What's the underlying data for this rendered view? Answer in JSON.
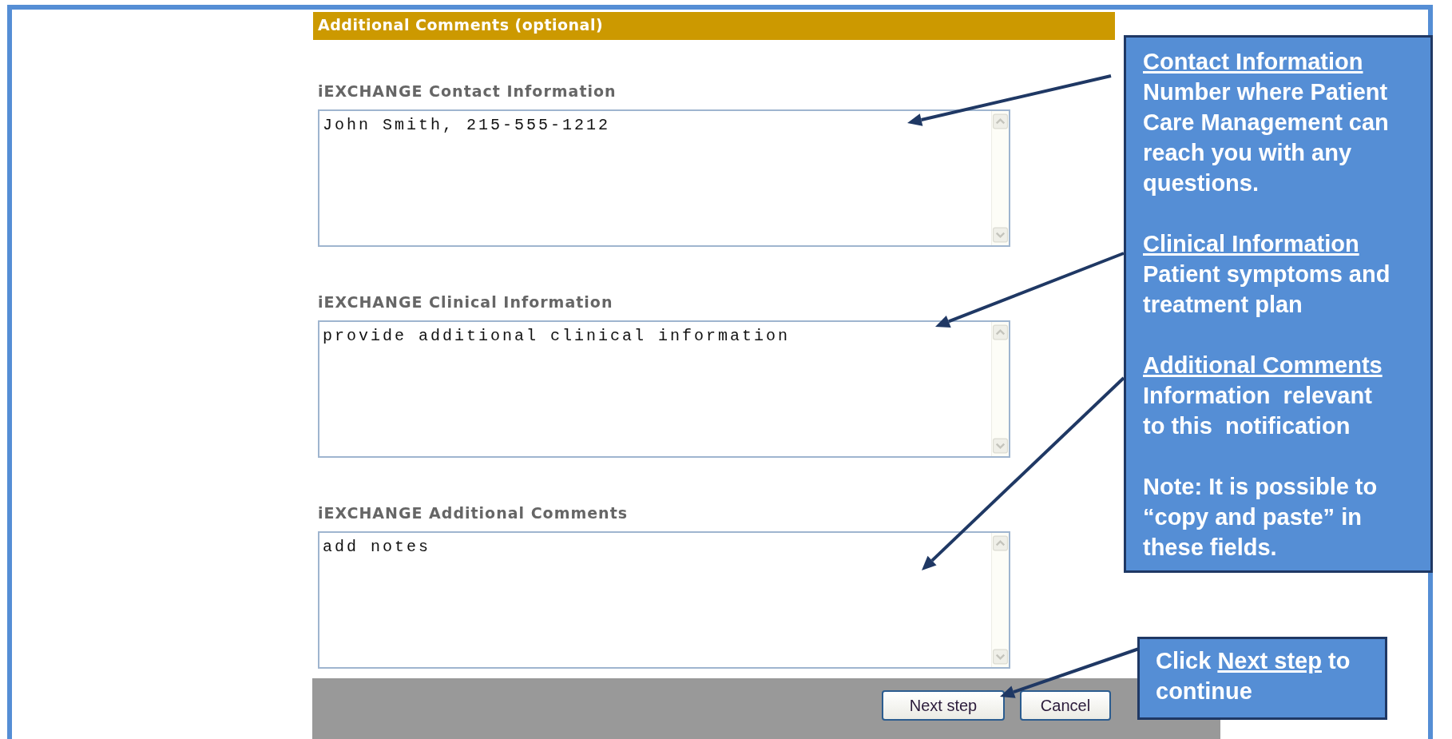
{
  "form": {
    "title": "Additional Comments (optional)",
    "fields": [
      {
        "label": "iEXCHANGE Contact Information",
        "value": "John Smith, 215-555-1212"
      },
      {
        "label": "iEXCHANGE Clinical Information",
        "value": "provide additional clinical information"
      },
      {
        "label": "iEXCHANGE Additional Comments",
        "value": "add notes"
      }
    ],
    "buttons": [
      {
        "label": "Next step"
      },
      {
        "label": "Cancel"
      }
    ]
  },
  "callouts": [
    {
      "sections": [
        {
          "heading": "Contact Information",
          "text": "Number where Patient Care Management can reach you with any questions."
        },
        {
          "heading": "Clinical Information",
          "text": "Patient symptoms and treatment plan"
        },
        {
          "heading": "Additional Comments",
          "text": "Information  relevant to this  notification"
        },
        {
          "text": "Note: It is possible to “copy and paste” in these fields."
        }
      ]
    },
    {
      "parts": [
        {
          "text": "Click ",
          "underline": false
        },
        {
          "text": "Next step",
          "underline": true
        },
        {
          "text": " to continue",
          "underline": false
        }
      ]
    }
  ]
}
